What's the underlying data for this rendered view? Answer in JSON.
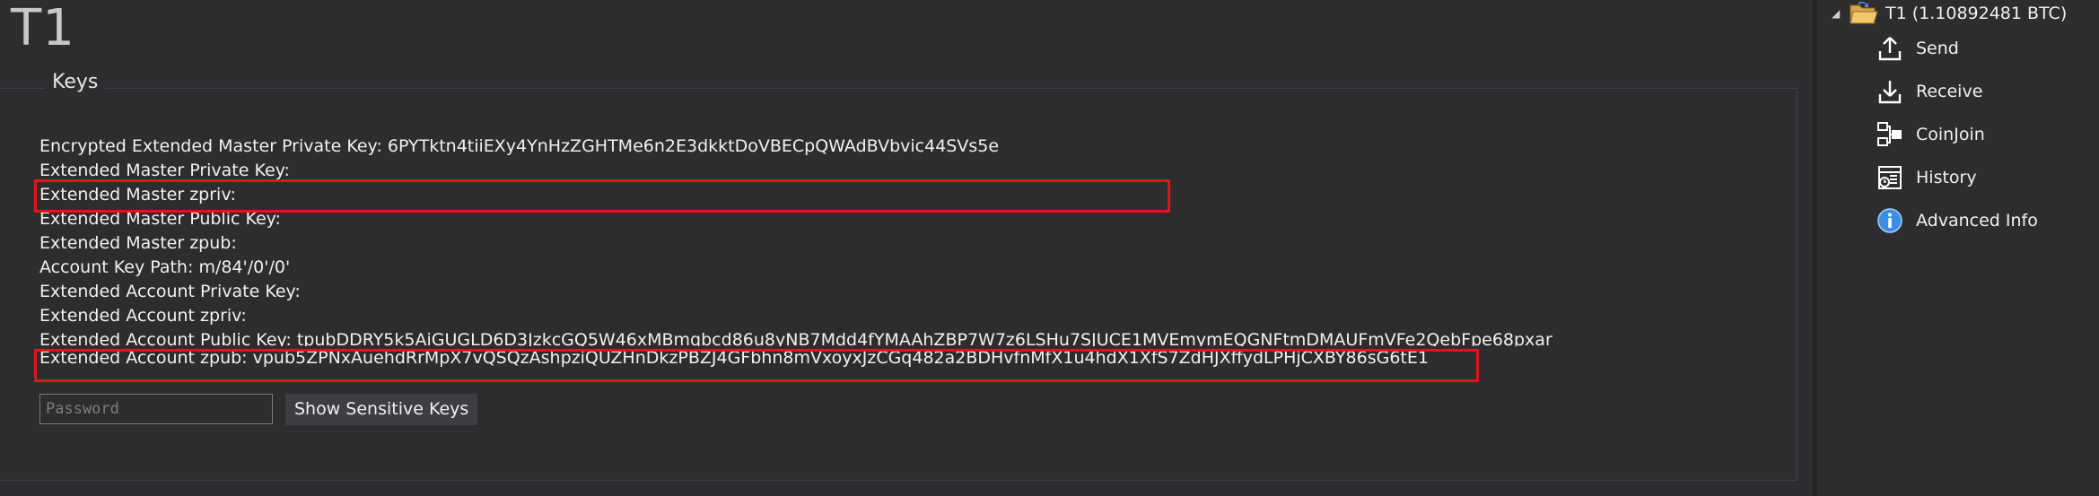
{
  "wallet": {
    "title": "T1"
  },
  "keys_section": {
    "header": "Keys",
    "lines": [
      {
        "label": "Encrypted Extended Master Private Key:",
        "value": "6PYTktn4tiiEXy4YnHzZGHTMe6n2E3dkktDoVBECpQWAdBVbvic44SVs5e"
      },
      {
        "label": "Extended Master Private Key:",
        "value": ""
      },
      {
        "label": "Extended Master zpriv:",
        "value": ""
      },
      {
        "label": "Extended Master Public Key:",
        "value": ""
      },
      {
        "label": "Extended Master zpub:",
        "value": ""
      },
      {
        "label": "Account Key Path:",
        "value": "m/84'/0'/0'"
      },
      {
        "label": "Extended Account Private Key:",
        "value": ""
      },
      {
        "label": "Extended Account zpriv:",
        "value": ""
      },
      {
        "label": "Extended Account Public Key:",
        "value": "tpubDDRY5k5AiGUGLD6D3JzkcGQ5W46xMBmqbcd86u8yNB7Mdd4fYMAAhZBP7W7z6LSHu7SJUCE1MVEmymEQGNFtmDMAUFmVFe2QebFpe68pxar"
      },
      {
        "label": "Extended Account zpub:",
        "value": "vpub5ZPNxAuehdRrMpX7vQSQzAshpziQUZHnDkzPBZJ4GFbhn8mVxoyxJzCGq482a2BDHvfnMfX1u4hdX1XfS7ZdHJXffydLPHjCXBY86sG6tE1"
      }
    ],
    "password_placeholder": "Password",
    "password_value": "",
    "show_button_label": "Show Sensitive Keys"
  },
  "highlight_color": "#e0141b",
  "sidebar": {
    "root_label": "T1 (1.10892481 BTC)",
    "root_icon": "wallet-folder-icon",
    "items": [
      {
        "label": "Send",
        "icon": "upload-icon"
      },
      {
        "label": "Receive",
        "icon": "download-icon"
      },
      {
        "label": "CoinJoin",
        "icon": "coinjoin-icon"
      },
      {
        "label": "History",
        "icon": "history-icon"
      },
      {
        "label": "Advanced Info",
        "icon": "info-icon"
      }
    ]
  }
}
